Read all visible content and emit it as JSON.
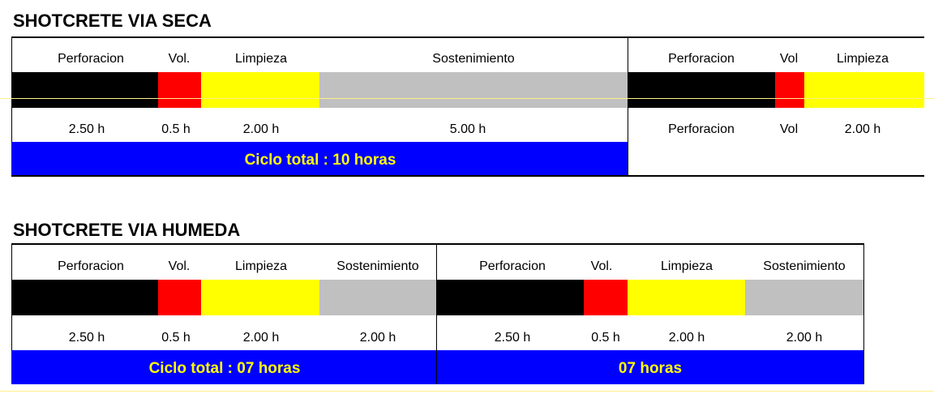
{
  "colors": {
    "perforacion": "#000000",
    "voladura": "#ff0000",
    "limpieza": "#ffff00",
    "sostenimiento": "#c0c0c0",
    "total_band": "#0000ff",
    "total_text": "#ffff00"
  },
  "seca": {
    "title": "SHOTCRETE VIA SECA",
    "main": {
      "headers": [
        "Perforacion",
        "Vol.",
        "Limpieza",
        "Sostenimiento"
      ],
      "durations": [
        "2.50 h",
        "0.5 h",
        "2.00 h",
        "5.00 h"
      ],
      "total": "Ciclo total : 10 horas"
    },
    "next": {
      "headers": [
        "Perforacion",
        "Vol",
        "Limpieza"
      ],
      "durations": [
        "Perforacion",
        "Vol",
        "2.00 h"
      ]
    }
  },
  "humeda": {
    "title": "SHOTCRETE VIA HUMEDA",
    "cycle1": {
      "headers": [
        "Perforacion",
        "Vol.",
        "Limpieza",
        "Sostenimiento"
      ],
      "durations": [
        "2.50 h",
        "0.5 h",
        "2.00 h",
        "2.00 h"
      ],
      "total": "Ciclo total : 07 horas"
    },
    "cycle2": {
      "headers": [
        "Perforacion",
        "Vol.",
        "Limpieza",
        "Sostenimiento"
      ],
      "durations": [
        "2.50 h",
        "0.5 h",
        "2.00 h",
        "2.00 h"
      ],
      "total": "07 horas"
    }
  }
}
